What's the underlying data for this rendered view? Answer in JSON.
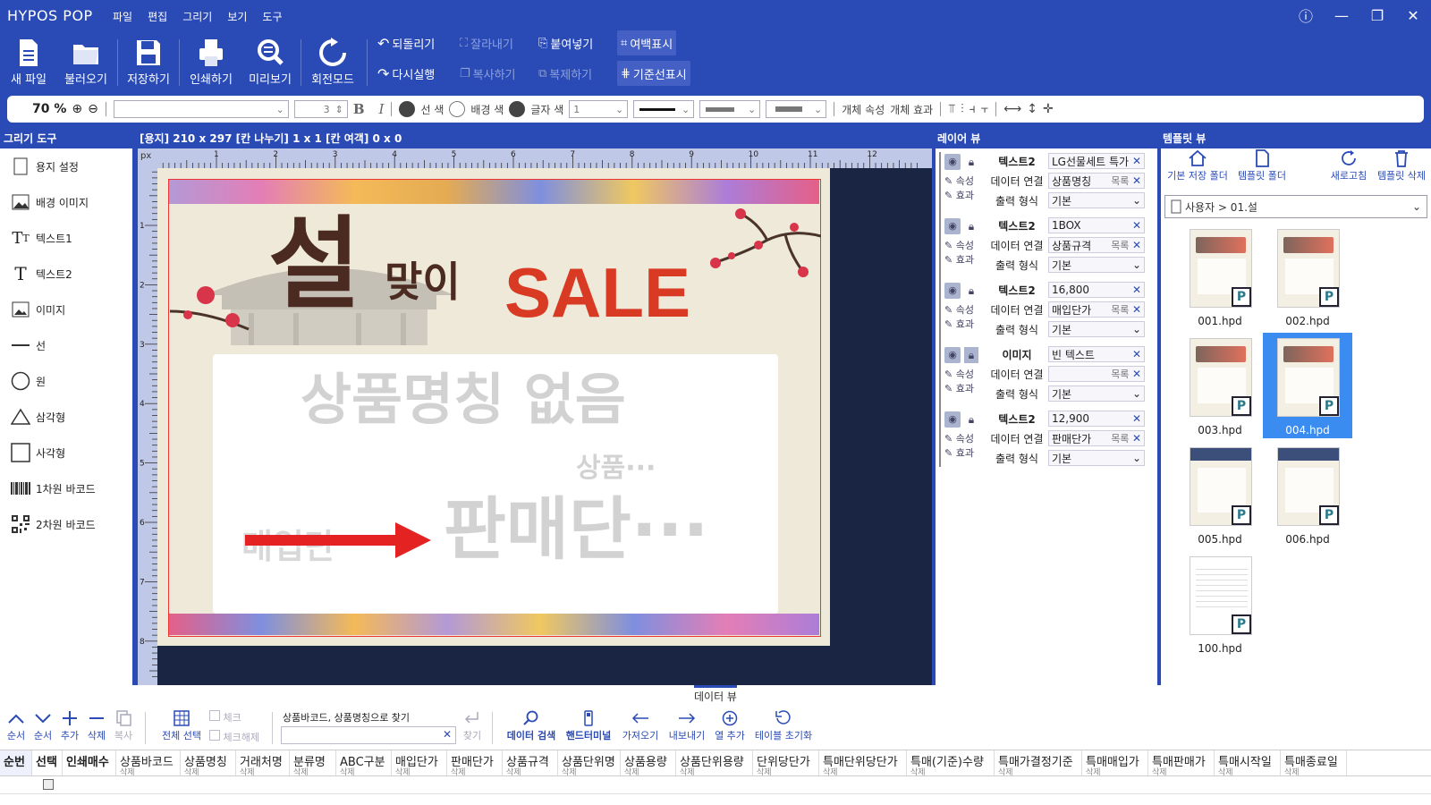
{
  "app": {
    "title": "HYPOS POP"
  },
  "menu": [
    "파일",
    "편집",
    "그리기",
    "보기",
    "도구"
  ],
  "window": {
    "info": "ⓘ",
    "minimize": "—",
    "restore": "❐",
    "close": "✕"
  },
  "toolbar": {
    "new_file": "새 파일",
    "open": "불러오기",
    "save": "저장하기",
    "print": "인쇄하기",
    "preview": "미리보기",
    "rotate_mode": "회전모드",
    "undo": "되돌리기",
    "redo": "다시실행",
    "cut": "잘라내기",
    "copy": "복사하기",
    "paste": "붙여넣기",
    "duplicate": "복제하기",
    "margin_display": "여백표시",
    "guideline_display": "기준선표시"
  },
  "format": {
    "zoom": "70 %",
    "font_size": "3",
    "bold": "B",
    "italic": "I",
    "line_color": "선 색",
    "bg_color": "배경 색",
    "text_color": "글자 색",
    "line_width": "1",
    "object_props": "개체 속성",
    "object_effect": "개체 효과"
  },
  "drawing_tools": {
    "title": "그리기 도구",
    "items": [
      "용지 설정",
      "배경 이미지",
      "텍스트1",
      "텍스트2",
      "이미지",
      "선",
      "원",
      "삼각형",
      "사각형",
      "1차원 바코드",
      "2차원 바코드"
    ]
  },
  "canvas": {
    "info": "[용지] 210 x 297  [칸 나누기] 1 x 1  [칸 여객] 0 x 0",
    "ruler_unit": "px",
    "ruler_h": [
      "1",
      "2",
      "3",
      "4",
      "5",
      "6",
      "7",
      "8",
      "9",
      "10",
      "11",
      "12"
    ],
    "ruler_v": [
      "1",
      "2",
      "3",
      "4",
      "5",
      "6",
      "7",
      "8"
    ],
    "poster": {
      "title_a": "설",
      "title_b": "맞이",
      "title_c": "SALE",
      "product_name": "상품명칭 없음",
      "product_sub": "상품···",
      "purchase_price": "매입단",
      "sale_price": "판매단···"
    }
  },
  "layer_view": {
    "title": "레이어 뷰",
    "attr": "속성",
    "effect": "효과",
    "data_link": "데이터 연결",
    "output_format": "출력 형식",
    "list": "목록",
    "default": "기본",
    "layers": [
      {
        "type": "텍스트2",
        "value": "LG선물세트 특가",
        "link": "상품명칭"
      },
      {
        "type": "텍스트2",
        "value": "1BOX",
        "link": "상품규격"
      },
      {
        "type": "텍스트2",
        "value": "16,800",
        "link": "매입단가"
      },
      {
        "type": "이미지",
        "value": "빈 텍스트",
        "link": ""
      },
      {
        "type": "텍스트2",
        "value": "12,900",
        "link": "판매단가"
      }
    ]
  },
  "template_view": {
    "title": "템플릿 뷰",
    "default_folder": "기본 저장 폴더",
    "template_folder": "템플릿 폴더",
    "refresh": "새로고침",
    "delete": "템플릿 삭제",
    "path": "사용자 > 01.설",
    "badge": "P",
    "items": [
      "001.hpd",
      "002.hpd",
      "003.hpd",
      "004.hpd",
      "005.hpd",
      "006.hpd",
      "100.hpd"
    ],
    "selected": "004.hpd"
  },
  "data_view": {
    "title": "데이터 뷰",
    "tools": {
      "order_up": "순서",
      "order_down": "순서",
      "add": "추가",
      "delete": "삭제",
      "copy": "복사",
      "select_all": "전체 선택",
      "check": "체크",
      "uncheck": "체크해제",
      "search_label": "상품바코드, 상품명칭으로 찾기",
      "find": "찾기",
      "data_search": "데이터 검색",
      "handy_terminal": "핸드터미널",
      "import": "가져오기",
      "export": "내보내기",
      "add_column": "열 추가",
      "reset_table": "테이블 초기화"
    },
    "delete_label": "삭제",
    "columns": [
      "순번",
      "선택",
      "인쇄매수",
      "상품바코드",
      "상품명칭",
      "거래처명",
      "분류명",
      "ABC구분",
      "매입단가",
      "판매단가",
      "상품규격",
      "상품단위명",
      "상품용량",
      "상품단위용량",
      "단위당단가",
      "특매단위당단가",
      "특매(기준)수량",
      "특매가결정기준",
      "특매매입가",
      "특매판매가",
      "특매시작일",
      "특매종료일"
    ]
  },
  "colors": {
    "accent": "#2a4ab6",
    "selected": "#3a8cf0",
    "sale_red": "#d83a24",
    "canvas_bg": "#1a2443"
  }
}
